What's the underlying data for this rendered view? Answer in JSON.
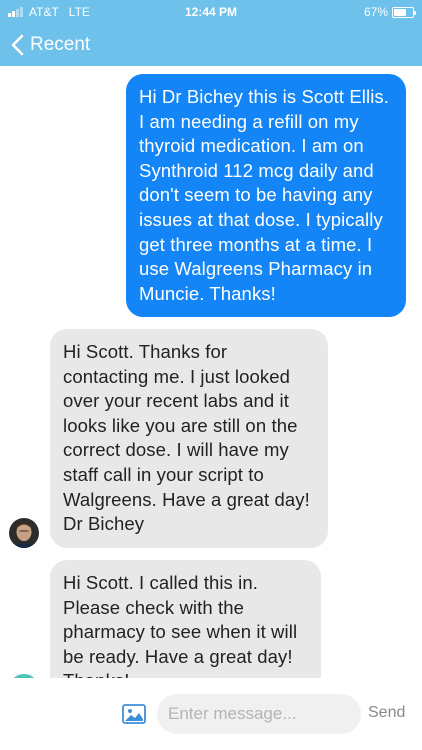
{
  "status_bar": {
    "carrier": "AT&T",
    "network": "LTE",
    "time": "12:44 PM",
    "battery_percent_label": "67%",
    "battery_level": 0.67
  },
  "nav": {
    "back_label": "Recent",
    "back_icon": "chevron-left-icon"
  },
  "messages": [
    {
      "direction": "outgoing",
      "text": "Hi Dr Bichey this is Scott Ellis.  I am needing a refill on my thyroid medication.  I am on Synthroid 112 mcg daily and don't seem to be having any issues at that dose.  I typically get three months at a time.  I use Walgreens Pharmacy in Muncie.  Thanks!"
    },
    {
      "direction": "incoming",
      "text": "Hi Scott. Thanks for contacting me.  I just looked over your recent labs and it looks like you are still on the correct dose.  I will have my staff call in your script to Walgreens.  Have a great day!  Dr Bichey"
    },
    {
      "direction": "incoming",
      "text": "Hi Scott.  I called this in.  Please check with the pharmacy to see when it will be ready.  Have a great day!  Thanks!"
    }
  ],
  "composer": {
    "image_icon": "image-icon",
    "placeholder": "Enter message...",
    "value": "",
    "send_label": "Send"
  },
  "colors": {
    "header": "#6ec1ea",
    "outgoing_bubble": "#1485f6",
    "incoming_bubble": "#e8e8e8",
    "second_avatar": "#4cc3b5"
  }
}
